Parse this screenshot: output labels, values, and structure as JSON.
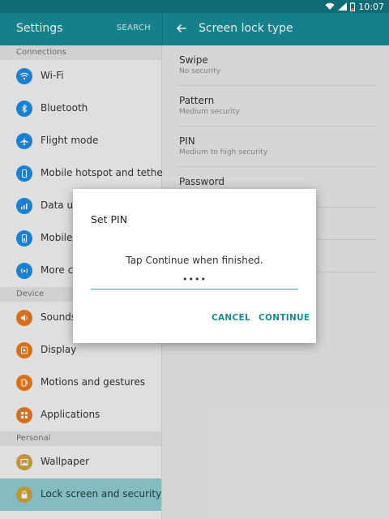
{
  "status_bar": {
    "time": "10:07"
  },
  "header": {
    "left_title": "Settings",
    "search_label": "SEARCH",
    "right_title": "Screen lock type"
  },
  "sidebar": {
    "sections": [
      {
        "label": "Connections"
      },
      {
        "label": "Device"
      },
      {
        "label": "Personal"
      }
    ],
    "items": [
      {
        "label": "Wi-Fi",
        "icon": "wifi-icon"
      },
      {
        "label": "Bluetooth",
        "icon": "bluetooth-icon"
      },
      {
        "label": "Flight mode",
        "icon": "airplane-icon"
      },
      {
        "label": "Mobile hotspot and tether..",
        "icon": "hotspot-icon"
      },
      {
        "label": "Data usa",
        "icon": "data-usage-icon"
      },
      {
        "label": "Mobile n",
        "icon": "mobile-networks-icon"
      },
      {
        "label": "More co",
        "icon": "more-connections-icon"
      },
      {
        "label": "Sounds",
        "icon": "sound-icon"
      },
      {
        "label": "Display",
        "icon": "display-icon"
      },
      {
        "label": "Motions and gestures",
        "icon": "motion-icon"
      },
      {
        "label": "Applications",
        "icon": "applications-icon"
      },
      {
        "label": "Wallpaper",
        "icon": "wallpaper-icon"
      },
      {
        "label": "Lock screen and security",
        "icon": "lock-icon",
        "active": true
      }
    ]
  },
  "lock_options": [
    {
      "title": "Swipe",
      "subtitle": "No security"
    },
    {
      "title": "Pattern",
      "subtitle": "Medium security"
    },
    {
      "title": "PIN",
      "subtitle": "Medium to high security"
    },
    {
      "title": "Password",
      "subtitle": ""
    }
  ],
  "dialog": {
    "title": "Set PIN",
    "message": "Tap Continue when finished.",
    "pin_value": "••••",
    "cancel_label": "CANCEL",
    "continue_label": "CONTINUE"
  },
  "colors": {
    "status_bar": "#0f6b74",
    "app_bar": "#188b96",
    "accent": "#1a8c97",
    "active_item": "#91cdd2"
  }
}
